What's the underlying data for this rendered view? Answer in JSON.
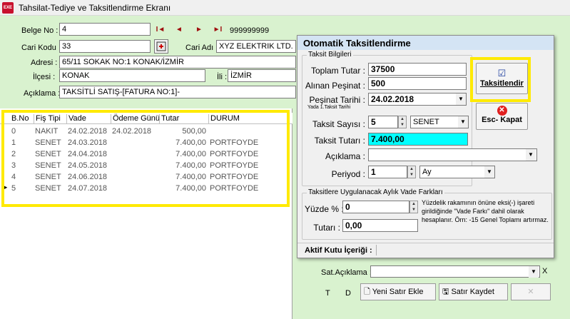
{
  "window": {
    "title": "Tahsilat-Tediye ve Taksitlendirme Ekranı",
    "icon_text": "EXE"
  },
  "form": {
    "belge_no_label": "Belge No :",
    "belge_no_value": "4",
    "record_count": "999999999",
    "cari_kodu_label": "Cari Kodu :",
    "cari_kodu_value": "33",
    "cari_adi_label": "Cari Adı :",
    "cari_adi_value": "XYZ ELEKTRIK LTD. Ş",
    "adresi_label": "Adresi :",
    "adresi_value": "65/11 SOKAK NO:1 KONAK/İZMİR",
    "ilcesi_label": "İlçesi :",
    "ilcesi_value": "KONAK",
    "ili_label": "İli :",
    "ili_value": "İZMİR",
    "aciklama_label": "Açıklama :",
    "aciklama_value": "TAKSİTLİ SATIŞ-[FATURA NO:1]-"
  },
  "nav": {
    "first": "I◄",
    "prev": "◄",
    "next": "►",
    "last": "►I"
  },
  "grid": {
    "columns": [
      "B.No",
      "Fiş Tipi",
      "Vade",
      "Ödeme Günü",
      "Tutar",
      "DURUM"
    ],
    "rows": [
      {
        "bno": "0",
        "fis": "NAKIT",
        "vade": "24.02.2018",
        "odeme": "24.02.2018",
        "tutar": "500,00",
        "durum": ""
      },
      {
        "bno": "1",
        "fis": "SENET",
        "vade": "24.03.2018",
        "odeme": "",
        "tutar": "7.400,00",
        "durum": "PORTFOYDE"
      },
      {
        "bno": "2",
        "fis": "SENET",
        "vade": "24.04.2018",
        "odeme": "",
        "tutar": "7.400,00",
        "durum": "PORTFOYDE"
      },
      {
        "bno": "3",
        "fis": "SENET",
        "vade": "24.05.2018",
        "odeme": "",
        "tutar": "7.400,00",
        "durum": "PORTFOYDE"
      },
      {
        "bno": "4",
        "fis": "SENET",
        "vade": "24.06.2018",
        "odeme": "",
        "tutar": "7.400,00",
        "durum": "PORTFOYDE"
      },
      {
        "bno": "5",
        "fis": "SENET",
        "vade": "24.07.2018",
        "odeme": "",
        "tutar": "7.400,00",
        "durum": "PORTFOYDE"
      }
    ],
    "row_pointer": "►"
  },
  "dialog": {
    "title": "Otomatik Taksitlendirme",
    "group1_label": "Taksit Bilgileri",
    "toplam_tutar_label": "Toplam Tutar :",
    "toplam_tutar_value": "37500",
    "alinan_pesinat_label": "Alınan Peşinat :",
    "alinan_pesinat_value": "500",
    "pesinat_tarihi_label": "Peşinat Tarihi :",
    "pesinat_tarihi_sub": "Yada 1.Taksit Tarihi",
    "pesinat_tarihi_value": "24.02.2018",
    "taksit_sayisi_label": "Taksit Sayısı :",
    "taksit_sayisi_value": "5",
    "taksit_tipi_value": "SENET",
    "taksit_tutari_label": "Taksit Tutarı :",
    "taksit_tutari_value": "7.400,00",
    "aciklama_label": "Açıklama :",
    "aciklama_value": "",
    "periyod_label": "Periyod :",
    "periyod_value": "1",
    "periyod_unit": "Ay",
    "taksitlendir_label": "Taksitlendir",
    "kapat_label": "Esc- Kapat",
    "group2_label": "Taksitlere Uygulanacak Aylık Vade Farkları",
    "yuzde_label": "Yüzde % :",
    "yuzde_value": "0",
    "tutar_label": "Tutarı :",
    "tutar_value": "0,00",
    "info_text": "Yüzdelik rakamının önüne eksi(-) işareti girildiğinde \"Vade Farkı\" dahil olarak hesaplanır. Örn: -15 Genel Toplamı artırmaz.",
    "status_label": "Aktif Kutu İçeriği :"
  },
  "bottom": {
    "sat_aciklama_label": "Sat.Açıklama :",
    "t_label": "T",
    "d_label": "D",
    "yeni_satir_label": "Yeni Satır Ekle",
    "satir_kaydet_label": "Satır Kaydet",
    "close_x": "X"
  }
}
